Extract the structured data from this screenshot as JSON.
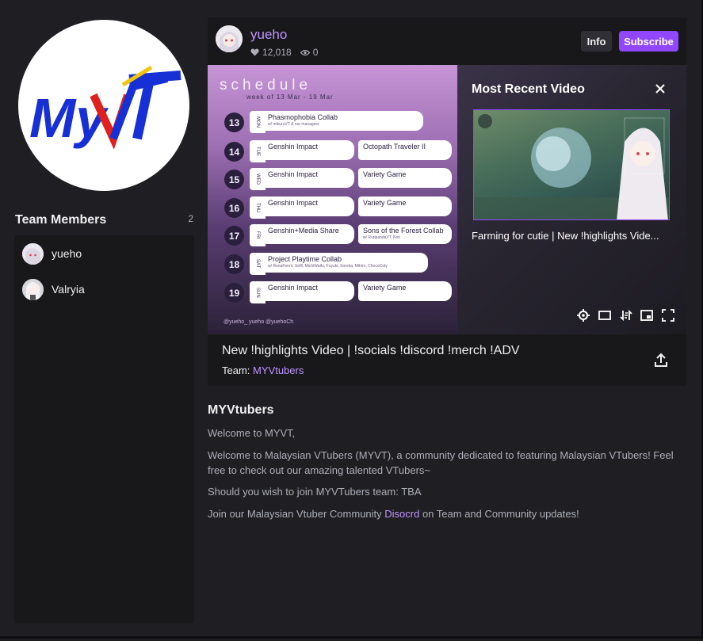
{
  "team": {
    "members_title": "Team Members",
    "members_count": "2",
    "members": [
      {
        "name": "yueho"
      },
      {
        "name": "Valryia"
      }
    ]
  },
  "channel": {
    "name": "yueho",
    "likes": "12,018",
    "viewers": "0",
    "info_label": "Info",
    "subscribe_label": "Subscribe",
    "stream_title": "New !highlights Video | !socials !discord !merch !ADV",
    "team_prefix": "Team:",
    "team_name": "MYVtubers"
  },
  "schedule_card": {
    "title": "schedule",
    "subtitle": "week of 13 Mar - 19 Mar",
    "rows": [
      {
        "day": "13",
        "wd": "MON",
        "events": [
          "Phasmophobia Collab"
        ],
        "note": "w/ mikuruVT & our managers"
      },
      {
        "day": "14",
        "wd": "TUE",
        "events": [
          "Genshin Impact",
          "Octopath Traveler II"
        ],
        "note": ""
      },
      {
        "day": "15",
        "wd": "WED",
        "events": [
          "Genshin Impact",
          "Variety Game"
        ],
        "note": ""
      },
      {
        "day": "16",
        "wd": "THU",
        "events": [
          "Genshin Impact",
          "Variety Game"
        ],
        "note": ""
      },
      {
        "day": "17",
        "wd": "FRI",
        "events": [
          "Genshin+Media Share",
          "Sons of the Forest Collab"
        ],
        "note": "w/ RuripandaVT, Kori"
      },
      {
        "day": "18",
        "wd": "SAT",
        "events": [
          "Project Playtime Collab"
        ],
        "note": "w/ RenaFenrir, Seffi, MichiWaifu, Fuyuki, Soreka, Mihiro, ChocoCoty"
      },
      {
        "day": "19",
        "wd": "SUN",
        "events": [
          "Genshin Impact",
          "Variety Game"
        ],
        "note": ""
      }
    ],
    "footer": "@yueho_    yueho    @yuehoCh"
  },
  "recent_video": {
    "heading": "Most Recent Video",
    "caption": "Farming for cutie | New !highlights Vide..."
  },
  "about": {
    "title": "MYVtubers",
    "p1": "Welcome to MYVT,",
    "p2": "Welcome to Malaysian VTubers (MYVT), a community dedicated to featuring Malaysian VTubers! Feel free to check out our amazing talented VTubers~",
    "p3": "Should you wish to join MYVTubers team: TBA",
    "p4_before": "Join our Malaysian Vtuber Community ",
    "p4_link": "Disocrd",
    "p4_after": " on Team and Community updates!"
  },
  "logo_text": "MyVT",
  "colors": {
    "accent": "#9147ff",
    "link": "#bf94ff",
    "bg": "#1f1f23",
    "panel": "#18181b"
  },
  "icons": {
    "likes": "heart-icon",
    "viewers": "eye-icon",
    "close": "close-icon",
    "settings": "gear-icon",
    "theatre": "theatre-mode-icon",
    "rewind": "clip-icon",
    "pip": "picture-in-picture-icon",
    "fullscreen": "fullscreen-icon",
    "share": "share-icon"
  }
}
